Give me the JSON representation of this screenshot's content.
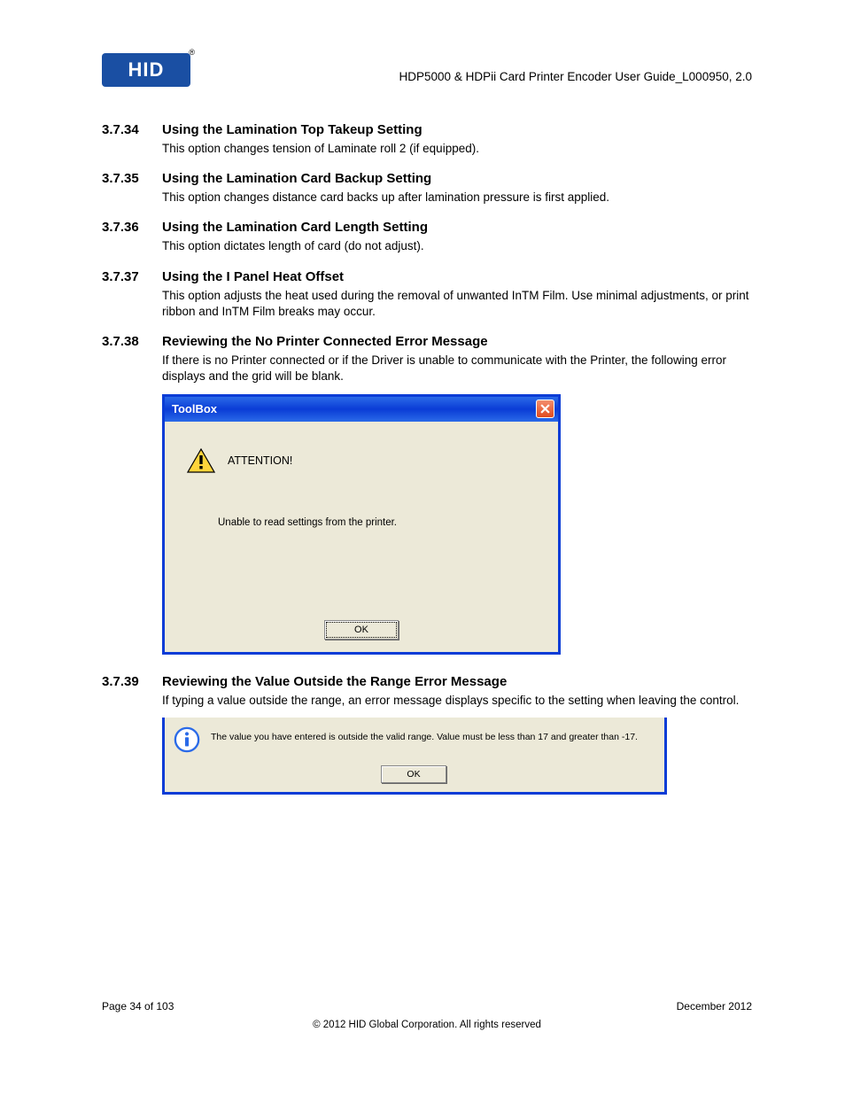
{
  "header": {
    "logo_text": "HID",
    "doc_title": "HDP5000 & HDPii Card Printer Encoder User Guide_L000950, 2.0"
  },
  "sections": [
    {
      "num": "3.7.34",
      "title": "Using the Lamination Top Takeup Setting",
      "body": "This option changes tension of Laminate roll 2 (if equipped)."
    },
    {
      "num": "3.7.35",
      "title": "Using the Lamination Card Backup Setting",
      "body": "This option changes distance card backs up after lamination pressure is first applied."
    },
    {
      "num": "3.7.36",
      "title": "Using the Lamination Card Length Setting",
      "body": "This option dictates length of card (do not adjust)."
    },
    {
      "num": "3.7.37",
      "title": "Using the I Panel Heat Offset",
      "body": "This option adjusts the heat used during the removal of unwanted InTM Film. Use minimal adjustments, or print ribbon and InTM Film breaks may occur."
    },
    {
      "num": "3.7.38",
      "title": "Reviewing the No Printer Connected Error Message",
      "body": "If there is no Printer connected or if the Driver is unable to communicate with the Printer, the following error displays and the grid will be blank."
    },
    {
      "num": "3.7.39",
      "title": "Reviewing the Value Outside the Range Error Message",
      "body": "If typing a value outside the range, an error message displays specific to the setting when leaving the control."
    }
  ],
  "dialog1": {
    "title": "ToolBox",
    "attention": "ATTENTION!",
    "message": "Unable to read settings from the printer.",
    "ok": "OK"
  },
  "dialog2": {
    "message": "The value you have entered is outside the valid range. Value must be less than 17 and greater than -17.",
    "ok": "OK"
  },
  "footer": {
    "page": "Page 34 of 103",
    "date": "December 2012",
    "copyright": "© 2012 HID Global Corporation. All rights reserved"
  }
}
